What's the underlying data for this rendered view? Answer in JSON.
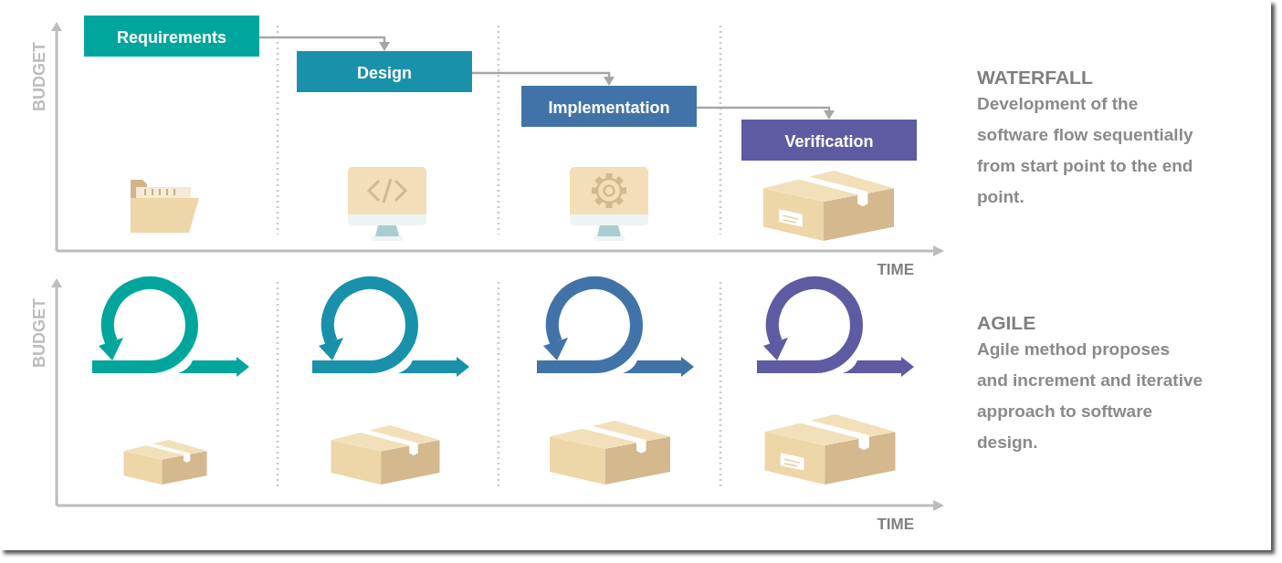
{
  "waterfall": {
    "axis_y": "BUDGET",
    "axis_x": "TIME",
    "title": "WATERFALL",
    "description": "Development of the software flow sequentially from start point to the end point.",
    "phases": [
      {
        "label": "Requirements",
        "color": "#00a69c",
        "kind": "folder"
      },
      {
        "label": "Design",
        "color": "#1991ab",
        "kind": "code-monitor"
      },
      {
        "label": "Implementation",
        "color": "#4273a8",
        "kind": "gear-monitor"
      },
      {
        "label": "Verification",
        "color": "#5e5ba2",
        "kind": "labeled-box"
      }
    ]
  },
  "agile": {
    "axis_y": "BUDGET",
    "axis_x": "TIME",
    "title": "AGILE",
    "description": "Agile method proposes and increment and iterative approach to software design.",
    "iterations": [
      {
        "color": "#00a69c",
        "kind": "small-box"
      },
      {
        "color": "#1991ab",
        "kind": "medium-box"
      },
      {
        "color": "#4273a8",
        "kind": "large-box"
      },
      {
        "color": "#5e5ba2",
        "kind": "labeled-box"
      }
    ]
  }
}
